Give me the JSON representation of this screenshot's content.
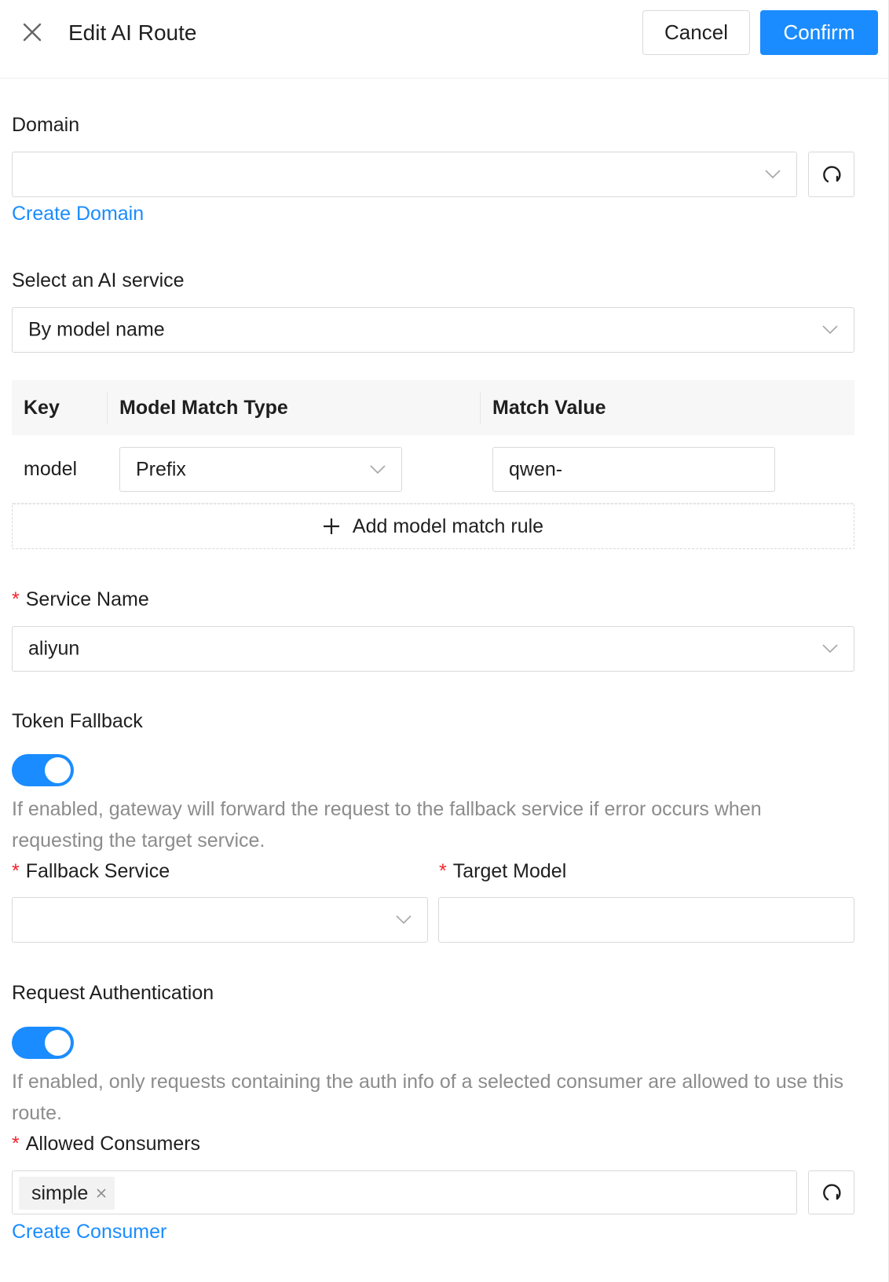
{
  "header": {
    "title": "Edit AI Route",
    "cancel_label": "Cancel",
    "confirm_label": "Confirm"
  },
  "domain": {
    "label": "Domain",
    "value": "",
    "create_link": "Create Domain"
  },
  "ai_service": {
    "label": "Select an AI service",
    "value": "By model name"
  },
  "match_table": {
    "headers": [
      "Key",
      "Model Match Type",
      "Match Value"
    ],
    "rows": [
      {
        "key": "model",
        "match_type": "Prefix",
        "match_value": "qwen-"
      }
    ],
    "add_rule_label": "Add model match rule"
  },
  "service_name": {
    "label": "Service Name",
    "value": "aliyun",
    "required": true
  },
  "token_fallback": {
    "label": "Token Fallback",
    "enabled": true,
    "help": "If enabled, gateway will forward the request to the fallback service if error occurs when requesting the target service.",
    "fallback_service_label": "Fallback Service",
    "fallback_service_value": "",
    "target_model_label": "Target Model",
    "target_model_value": ""
  },
  "request_auth": {
    "label": "Request Authentication",
    "enabled": true,
    "help": "If enabled, only requests containing the auth info of a selected consumer are allowed to use this route.",
    "consumers_label": "Allowed Consumers",
    "consumers": [
      "simple"
    ],
    "create_link": "Create Consumer"
  },
  "colors": {
    "primary": "#1a8cff",
    "required": "#f5222d",
    "help_text": "#8c8c8c"
  },
  "icons": {
    "close": "close-icon",
    "chevron": "chevron-down-icon",
    "refresh": "refresh-icon",
    "plus": "plus-icon",
    "tag_close": "tag-close-icon"
  }
}
